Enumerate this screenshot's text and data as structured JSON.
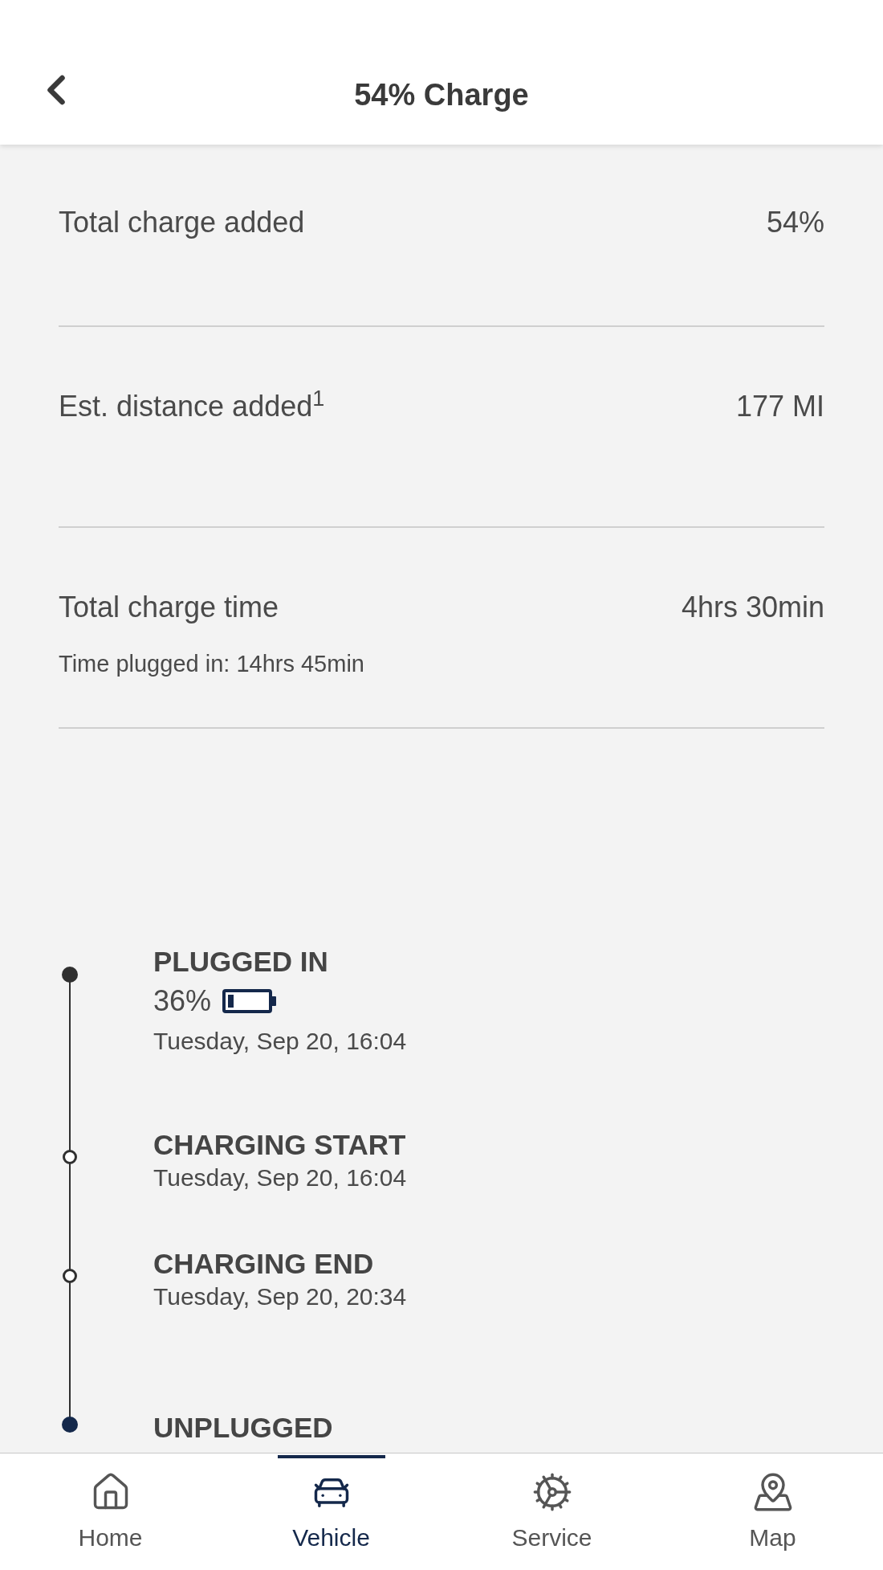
{
  "header": {
    "title": "54% Charge"
  },
  "stats": [
    {
      "label": "Total charge added",
      "value": "54%"
    },
    {
      "label": "Est. distance added$^{1}$",
      "value": "177 MI"
    },
    {
      "label": "Total charge time",
      "value": "4hrs 30min",
      "note": "Time plugged in: 14hrs 45min"
    }
  ],
  "timeline": [
    {
      "kind": "solid",
      "title": "PLUGGED IN",
      "percent": "36%",
      "battery": {
        "level": 0.15
      },
      "time": "Tuesday, Sep 20, 16:04"
    },
    {
      "kind": "open",
      "title": "CHARGING START",
      "time": "Tuesday, Sep 20, 16:04"
    },
    {
      "kind": "open",
      "title": "CHARGING END",
      "time": "Tuesday, Sep 20, 20:34"
    },
    {
      "kind": "accent",
      "title": "UNPLUGGED"
    }
  ],
  "tab_bar": [
    {
      "label": "Home",
      "kind": "home",
      "selected": false
    },
    {
      "label": "Vehicle",
      "kind": "car",
      "selected": true
    },
    {
      "label": "Service",
      "kind": "service",
      "selected": false
    },
    {
      "label": "Map",
      "kind": "map",
      "selected": false
    }
  ]
}
